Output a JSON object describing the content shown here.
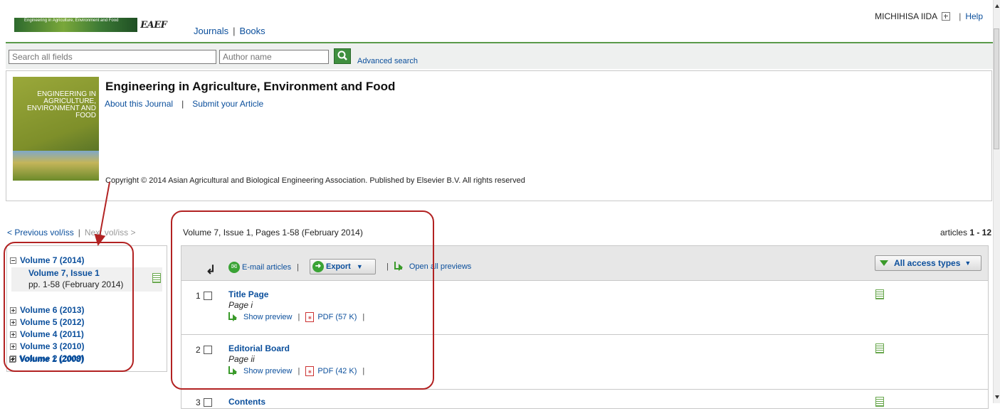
{
  "header": {
    "logo_banner": "Engineering in Agriculture, Environment and Food",
    "logo_mark": "EAEF",
    "nav": {
      "journals": "Journals",
      "books": "Books"
    },
    "user": "MICHIHISA IIDA",
    "help": "Help"
  },
  "search": {
    "all_placeholder": "Search all fields",
    "author_placeholder": "Author name",
    "advanced": "Advanced search"
  },
  "journal": {
    "title": "Engineering in Agriculture, Environment and Food",
    "about": "About this Journal",
    "submit": "Submit your Article",
    "cover_text": "ENGINEERING IN AGRICULTURE, ENVIRONMENT AND FOOD",
    "copyright": "Copyright © 2014 Asian Agricultural and Biological Engineering Association. Published by Elsevier B.V. All rights reserved"
  },
  "volnav": {
    "prev": "< Previous vol/iss",
    "next": "Next vol/iss >"
  },
  "issue": {
    "heading": "Volume 7, Issue 1, Pages 1-58 (February 2014)",
    "count_prefix": "articles",
    "count_range": "1 - 12"
  },
  "tree": {
    "current_volume": "Volume 7 (2014)",
    "current_issue": "Volume 7, Issue 1",
    "current_pages": "pp. 1-58 (February 2014)",
    "volumes": [
      "Volume 6 (2013)",
      "Volume 5 (2012)",
      "Volume 4 (2011)",
      "Volume 3 (2010)",
      "Volume 2 (2009)",
      "Volume 1 (2008)"
    ]
  },
  "toolbar": {
    "email": "E-mail articles",
    "export": "Export",
    "open_all": "Open all previews",
    "access": "All access types"
  },
  "articles": [
    {
      "num": "1",
      "title": "Title Page",
      "page": "Page i",
      "preview": "Show preview",
      "pdf": "PDF (57 K)"
    },
    {
      "num": "2",
      "title": "Editorial Board",
      "page": "Page ii",
      "preview": "Show preview",
      "pdf": "PDF (42 K)"
    },
    {
      "num": "3",
      "title": "Contents"
    }
  ],
  "colors": {
    "link": "#0b4f9c",
    "accent_green": "#3a9a2a",
    "annotation": "#b22222"
  }
}
